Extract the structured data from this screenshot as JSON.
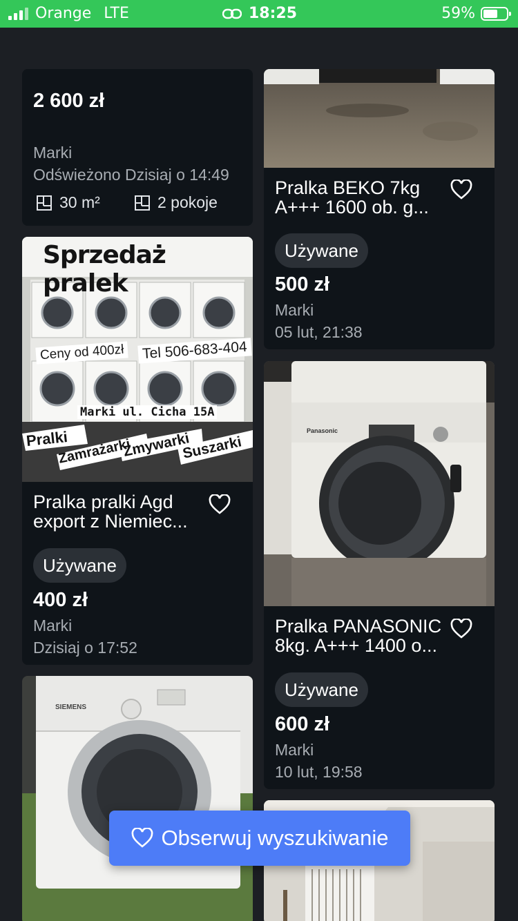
{
  "status_bar": {
    "carrier": "Orange",
    "network": "LTE",
    "time": "18:25",
    "battery": "59%"
  },
  "listings": [
    {
      "price": "2 600 zł",
      "location": "Marki",
      "date": "Odświeżono Dzisiaj o 14:49",
      "area": "30 m²",
      "rooms": "2 pokoje"
    },
    {
      "title": "Pralka BEKO 7kg A+++ 1600 ob. g...",
      "condition": "Używane",
      "price": "500 zł",
      "location": "Marki",
      "date": "05 lut, 21:38"
    },
    {
      "title": "Pralka pralki Agd export z Niemiec...",
      "condition": "Używane",
      "price": "400 zł",
      "location": "Marki",
      "date": "Dzisiaj o 17:52",
      "poster": {
        "headline": "Sprzedaż pralek",
        "prices_from": "Ceny od 400zł",
        "phone": "Tel 506-683-404",
        "address": "Marki ul. Cicha 15A",
        "tags": [
          "Pralki",
          "Zamrażarki",
          "Zmywarki",
          "Suszarki"
        ]
      }
    },
    {
      "title": "Pralka PANASONIC 8kg. A+++ 1400 o...",
      "condition": "Używane",
      "price": "600 zł",
      "location": "Marki",
      "date": "10 lut, 19:58",
      "brand_on_photo": "Panasonic"
    },
    {
      "brand_on_photo": "SIEMENS"
    }
  ],
  "follow_button": {
    "label": "Obserwuj wyszukiwanie",
    "color": "#4d7cf7"
  },
  "colors": {
    "status_bar": "#34c759",
    "background": "#1c1f24",
    "card": "#0f1419",
    "badge": "#2b3036"
  }
}
